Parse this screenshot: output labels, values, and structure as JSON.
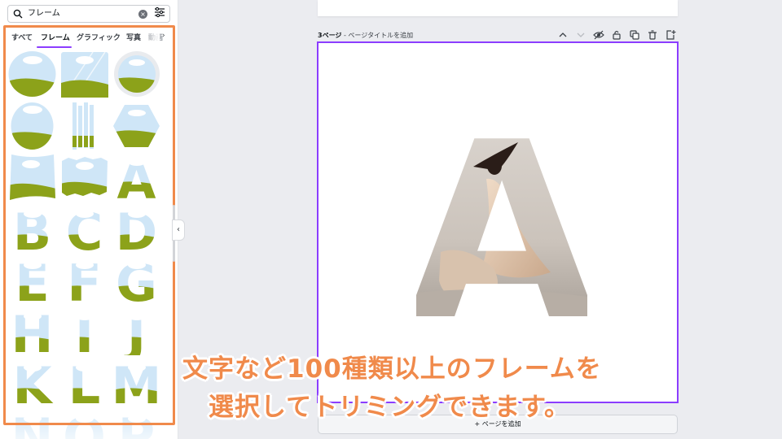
{
  "search": {
    "query": "フレーム"
  },
  "tabs": [
    {
      "label": "すべて"
    },
    {
      "label": "フレーム"
    },
    {
      "label": "グラフィック"
    },
    {
      "label": "写真"
    },
    {
      "label": "動画"
    }
  ],
  "frame_letters": [
    "A",
    "B",
    "C",
    "D",
    "E",
    "F",
    "G",
    "H",
    "I",
    "J",
    "K",
    "L",
    "M",
    "N",
    "O",
    "P"
  ],
  "editor": {
    "page_number": "3ページ",
    "page_title_placeholder": "ページタイトルを追加",
    "frame_letter": "A",
    "add_page": "ページを追加"
  },
  "caption": {
    "line1": "文字など100種類以上のフレームを",
    "line2": "選択してトリミングできます。"
  },
  "colors": {
    "accent": "#8b3dff",
    "highlight": "#f08a4b",
    "sky": "#cfe6f7",
    "grass": "#8ca21a"
  }
}
